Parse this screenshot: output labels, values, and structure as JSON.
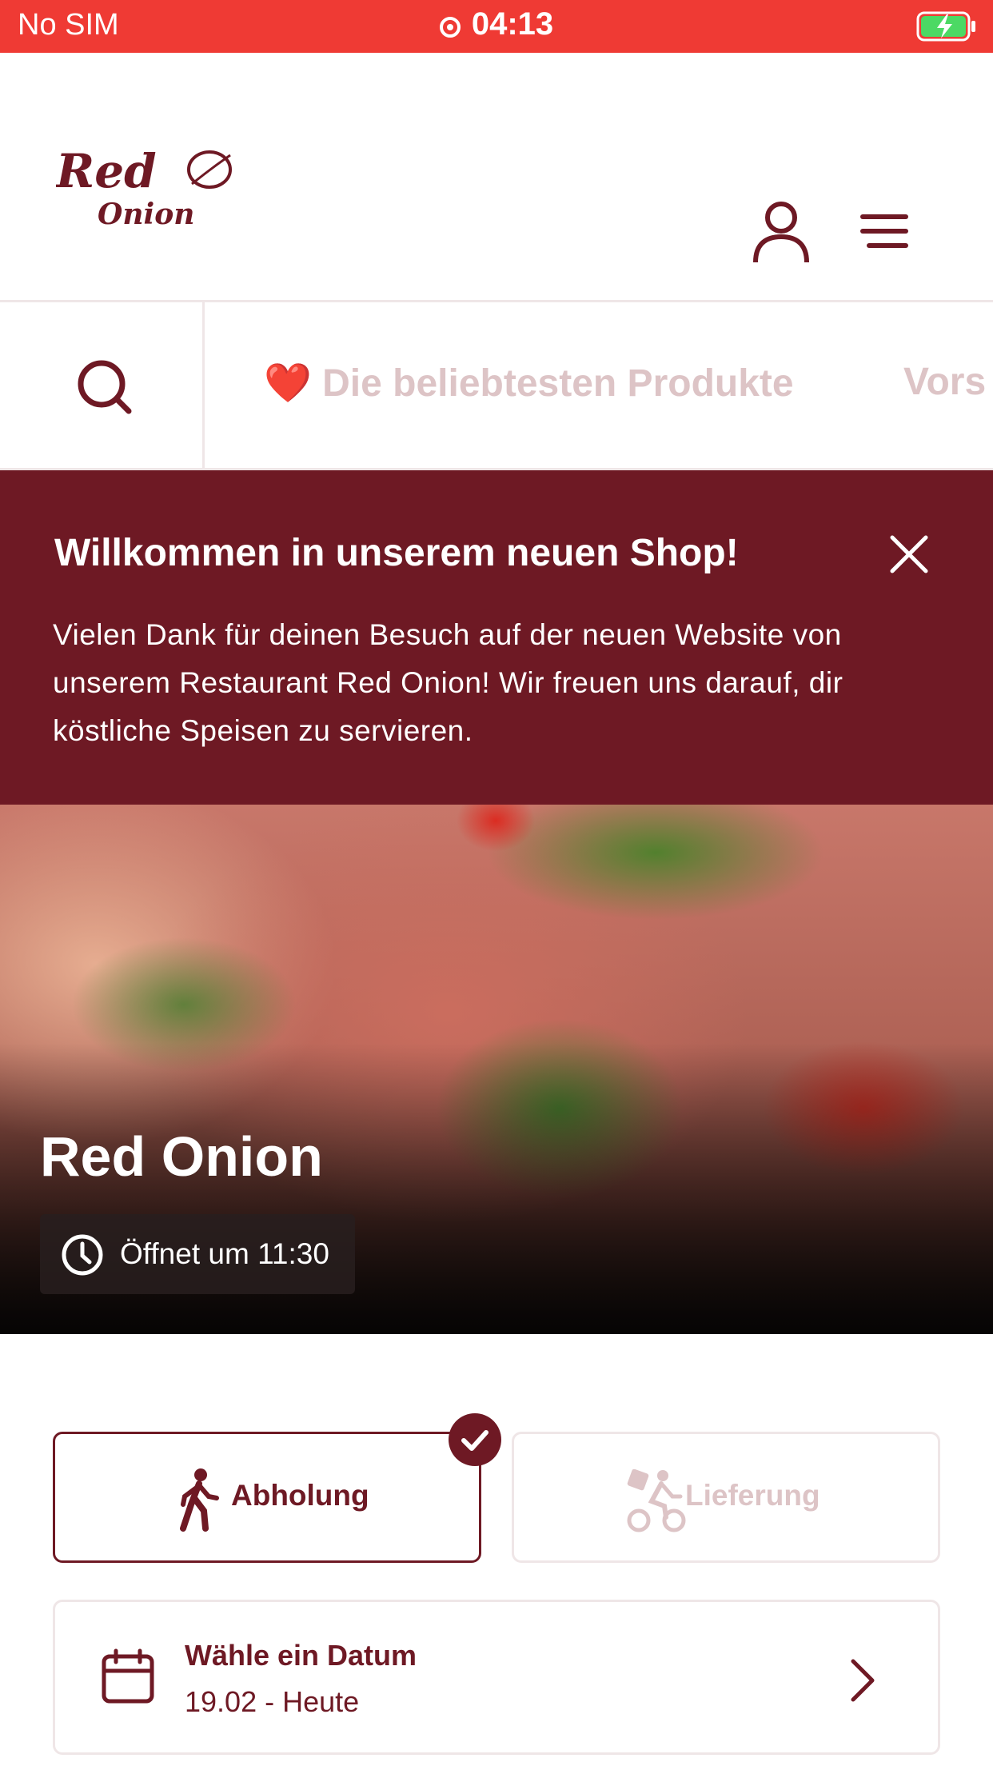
{
  "status_bar": {
    "carrier": "No SIM",
    "time": "04:13"
  },
  "header": {
    "logo_text_line1": "Red",
    "logo_text_line2": "Onion"
  },
  "category_nav": {
    "items": [
      {
        "emoji": "❤️",
        "label": "Die beliebtesten Produkte"
      },
      {
        "label": "Vors"
      }
    ]
  },
  "banner": {
    "title": "Willkommen in unserem neuen Shop!",
    "text": "Vielen Dank für deinen Besuch auf der neuen Website von unserem Restaurant Red Onion! Wir freuen uns darauf, dir köstliche Speisen zu servieren."
  },
  "hero": {
    "title": "Red Onion",
    "hours": "Öffnet um 11:30"
  },
  "order_mode": {
    "pickup_label": "Abholung",
    "delivery_label": "Lieferung",
    "selected": "Abholung"
  },
  "date_picker": {
    "title": "Wähle ein Datum",
    "value": "19.02 - Heute"
  },
  "colors": {
    "brand": "#6e1924",
    "status_bar": "#ef3a34",
    "muted_text": "#ddc4c6",
    "divider": "#efe6e7"
  }
}
